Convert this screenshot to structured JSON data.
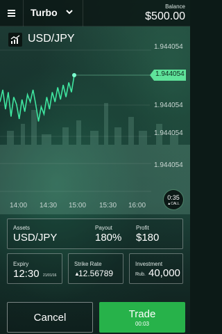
{
  "header": {
    "mode_label": "Turbo",
    "balance_label": "Balance",
    "balance_value": "$500.00"
  },
  "asset": {
    "name": "USD/JPY"
  },
  "chart": {
    "current_price": "1.944054",
    "price_levels": [
      "1.944054",
      "1.944054",
      "1.944054",
      "1.944054",
      "1.944054"
    ],
    "time_ticks": [
      "14:00",
      "14:30",
      "15:00",
      "15:30",
      "16:00"
    ],
    "timer_time": "0:35",
    "timer_direction": "▲CALL",
    "line_color": "#3fe6a0",
    "marker_color": "#7dffd0",
    "tag_color": "#5fe39a"
  },
  "chart_data": {
    "type": "line",
    "x": [
      "14:00",
      "14:30",
      "15:00"
    ],
    "series": [
      {
        "values": [
          0.55,
          0.3,
          0.7,
          0.35,
          0.85,
          0.45,
          0.6,
          0.9,
          0.5,
          0.75,
          0.4,
          0.55,
          0.3,
          0.6,
          0.95,
          0.65,
          0.8,
          0.45,
          0.7,
          0.35,
          0.55,
          0.25,
          0.5,
          0.2,
          0.45,
          0.15,
          0.35,
          0.0
        ]
      }
    ]
  },
  "summary": {
    "assets_label": "Assets",
    "assets_value": "USD/JPY",
    "payout_label": "Payout",
    "payout_value": "180%",
    "profit_label": "Profit",
    "profit_value": "$180"
  },
  "expiry": {
    "label": "Expiry",
    "time": "12:30",
    "date": "21/01/16"
  },
  "strike": {
    "label": "Strike Rate",
    "value": "12.56789",
    "arrow": "▲"
  },
  "investment": {
    "label": "Investment",
    "currency": "Rub.",
    "value": "40,000"
  },
  "actions": {
    "cancel_label": "Cancel",
    "trade_label": "Trade",
    "trade_timer": "00:03"
  }
}
